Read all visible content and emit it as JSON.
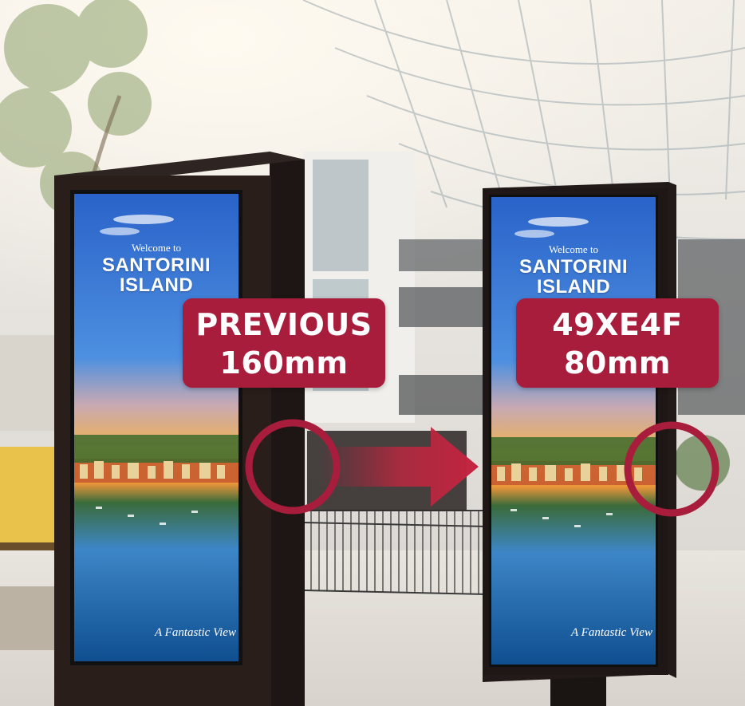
{
  "comparison": {
    "previous": {
      "name": "PREVIOUS",
      "value": "160mm"
    },
    "new": {
      "name": "49XE4F",
      "value": "80mm"
    }
  },
  "screen_content": {
    "welcome": "Welcome to",
    "title_line1": "SANTORINI",
    "title_line2": "ISLAND",
    "tagline": "A Fantastic View"
  },
  "colors": {
    "accent": "#a81d3c",
    "kiosk_frame": "#2a1e1b",
    "sky": "#3b6fd0",
    "sunset": "#f2b24c",
    "sea": "#1f6fb3"
  },
  "icons": [
    "arrow-right-icon",
    "highlight-circle-icon"
  ]
}
